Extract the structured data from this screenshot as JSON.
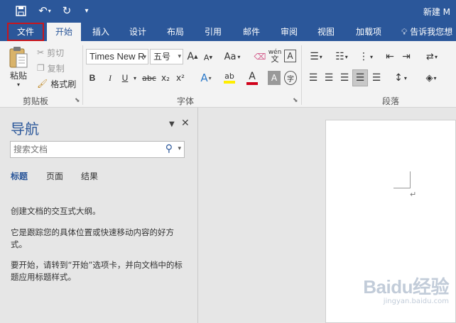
{
  "titlebar": {
    "save_icon": "save-icon",
    "undo_icon": "undo-icon",
    "redo_icon": "redo-icon",
    "customize_icon": "customize-qat-icon",
    "doc_title": "新建 M"
  },
  "tabs": [
    {
      "label": "文件",
      "state": "highlighted"
    },
    {
      "label": "开始",
      "state": "active"
    },
    {
      "label": "插入"
    },
    {
      "label": "设计"
    },
    {
      "label": "布局"
    },
    {
      "label": "引用"
    },
    {
      "label": "邮件"
    },
    {
      "label": "审阅"
    },
    {
      "label": "视图"
    },
    {
      "label": "加载项"
    }
  ],
  "tell_me": {
    "icon": "lightbulb-icon",
    "label": "告诉我您想"
  },
  "ribbon": {
    "clipboard": {
      "label": "剪贴板",
      "paste": "粘贴",
      "cut": "剪切",
      "copy": "复制",
      "format_painter": "格式刷"
    },
    "font": {
      "label": "字体",
      "font_name": "Times New R",
      "font_size": "五号",
      "grow": "A",
      "shrink": "A",
      "change_case": "Aa",
      "wen": "wén",
      "bold": "B",
      "italic": "I",
      "underline": "U",
      "strike": "abc",
      "subscript": "x₂",
      "superscript": "x²",
      "text_effect": "A",
      "font_color": "A",
      "char_shading": "A",
      "enclose": "字",
      "border_char": "A"
    },
    "paragraph": {
      "label": "段落"
    }
  },
  "nav": {
    "title": "导航",
    "search_placeholder": "搜索文档",
    "tabs": [
      "标题",
      "页面",
      "结果"
    ],
    "text1": "创建文档的交互式大纲。",
    "text2": "它是跟踪您的具体位置或快速移动内容的好方式。",
    "text3": "要开始，请转到“开始”选项卡，并向文档中的标题应用标题样式。"
  },
  "watermark": {
    "logo": "Baidu经验",
    "sub": "jingyan.baidu.com"
  },
  "colors": {
    "accent": "#2b579a",
    "highlight_border": "#c8161d"
  }
}
